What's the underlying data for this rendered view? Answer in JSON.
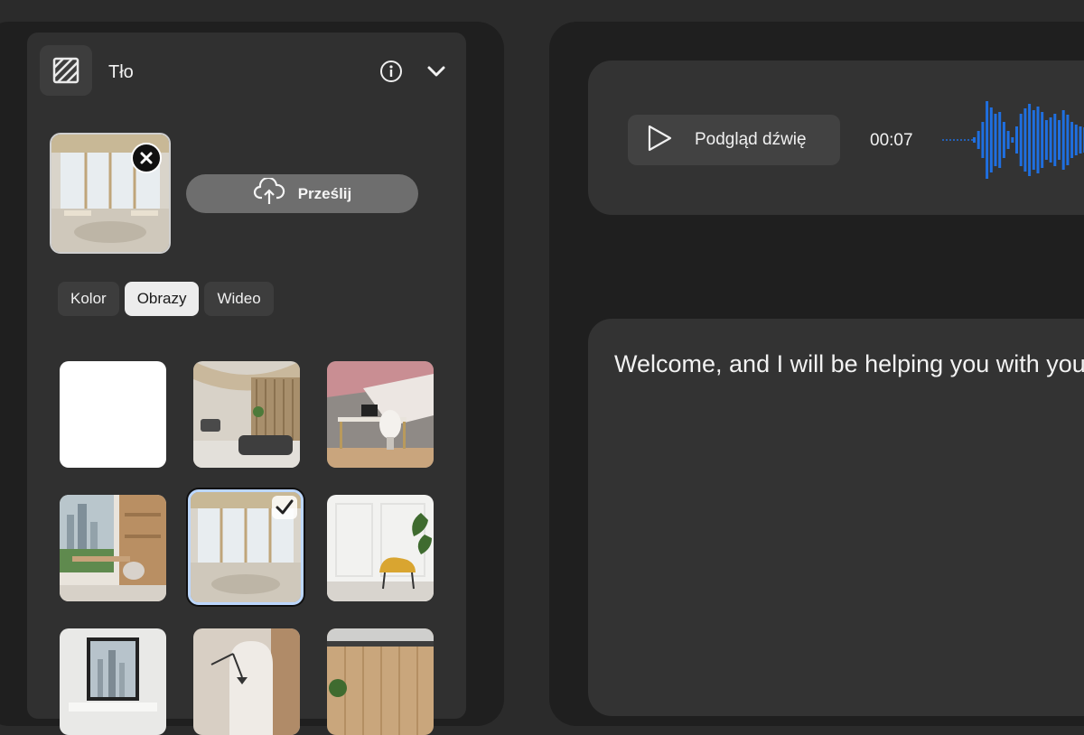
{
  "panel": {
    "title": "Tło",
    "icon": "background-pattern-icon",
    "info_icon": "info-icon",
    "collapse_icon": "chevron-down-icon"
  },
  "current_background": {
    "remove_icon": "close-icon"
  },
  "upload": {
    "label": "Prześlij",
    "icon": "cloud-upload-icon"
  },
  "tabs": [
    {
      "label": "Kolor",
      "active": false
    },
    {
      "label": "Obrazy",
      "active": true
    },
    {
      "label": "Wideo",
      "active": false
    }
  ],
  "images": {
    "selected_index": 4,
    "tiles": [
      {
        "name": "blank-white"
      },
      {
        "name": "lounge-office"
      },
      {
        "name": "pink-desk-office"
      },
      {
        "name": "city-view-office"
      },
      {
        "name": "bright-window-office"
      },
      {
        "name": "white-wall-armchair"
      },
      {
        "name": "conference-room"
      },
      {
        "name": "arch-lamp-room"
      },
      {
        "name": "wood-panel-meeting"
      }
    ]
  },
  "audio": {
    "preview_label": "Podgląd dźwię",
    "play_icon": "play-icon",
    "time": "00:07",
    "accent_color": "#1f6fe0"
  },
  "script": {
    "text": "Welcome, and I will be helping you with your"
  }
}
